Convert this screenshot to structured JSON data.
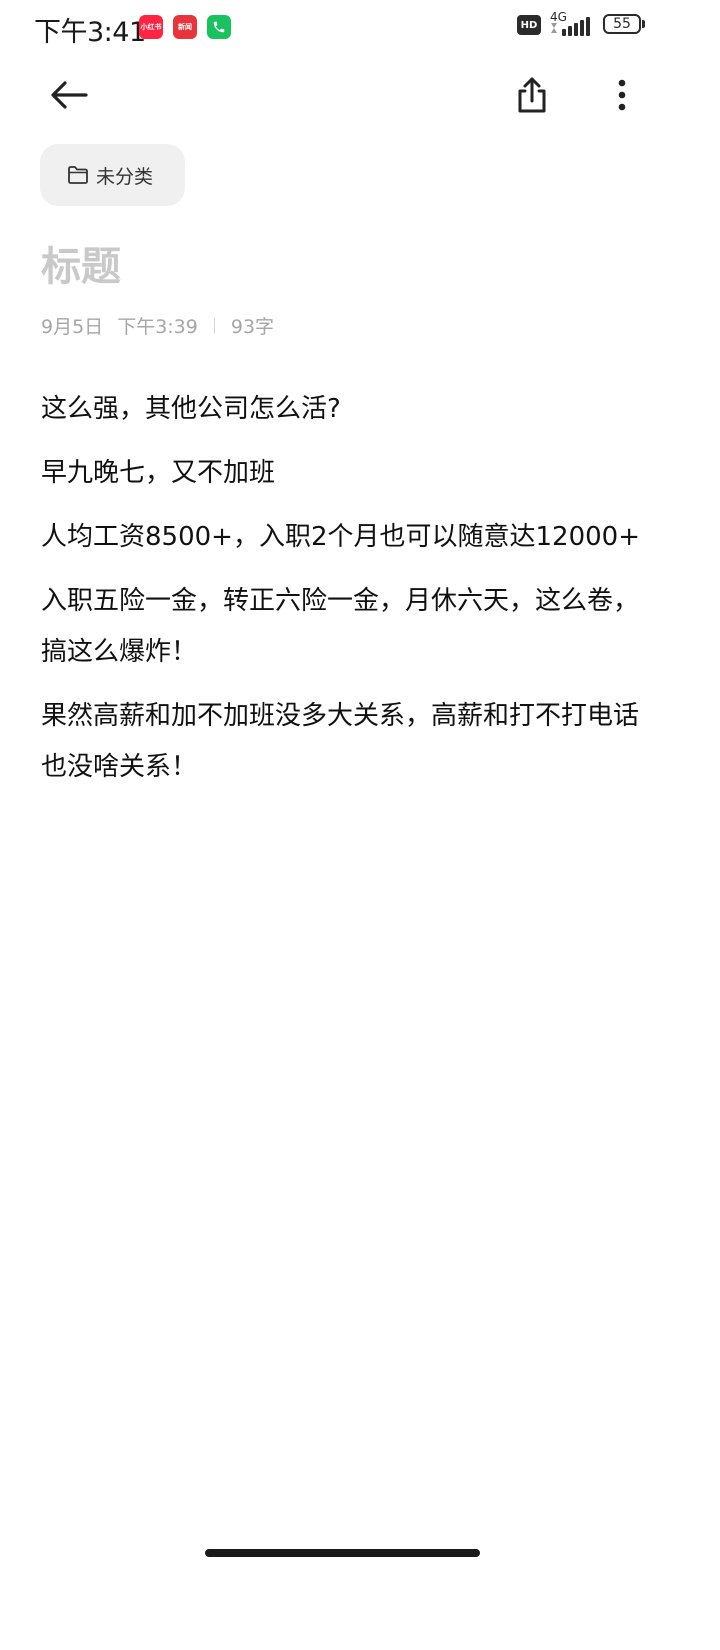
{
  "status_bar": {
    "time": "下午3:41",
    "notifications": [
      {
        "icon": "xiaohongshu-app-icon",
        "label": "小红书",
        "color": "#ff2442"
      },
      {
        "icon": "news-app-icon",
        "label": "新闻",
        "color": "#e8343b"
      },
      {
        "icon": "phone-call-icon",
        "color": "#19c25f"
      }
    ],
    "hd": "HD",
    "network": "4G",
    "battery": "55"
  },
  "toolbar": {
    "back_icon": "arrow-left-icon",
    "share_icon": "share-icon",
    "more_icon": "more-vertical-icon"
  },
  "note": {
    "category": "未分类",
    "title_placeholder": "标题",
    "date": "9月5日",
    "time": "下午3:39",
    "word_count": "93字",
    "paragraphs": [
      "这么强，其他公司怎么活?",
      "早九晚七，又不加班",
      "人均工资8500+，入职2个月也可以随意达12000+",
      "入职五险一金，转正六险一金，月休六天，这么卷，搞这么爆炸！",
      "果然高薪和加不加班没多大关系，高薪和打不打电话也没啥关系！"
    ]
  }
}
